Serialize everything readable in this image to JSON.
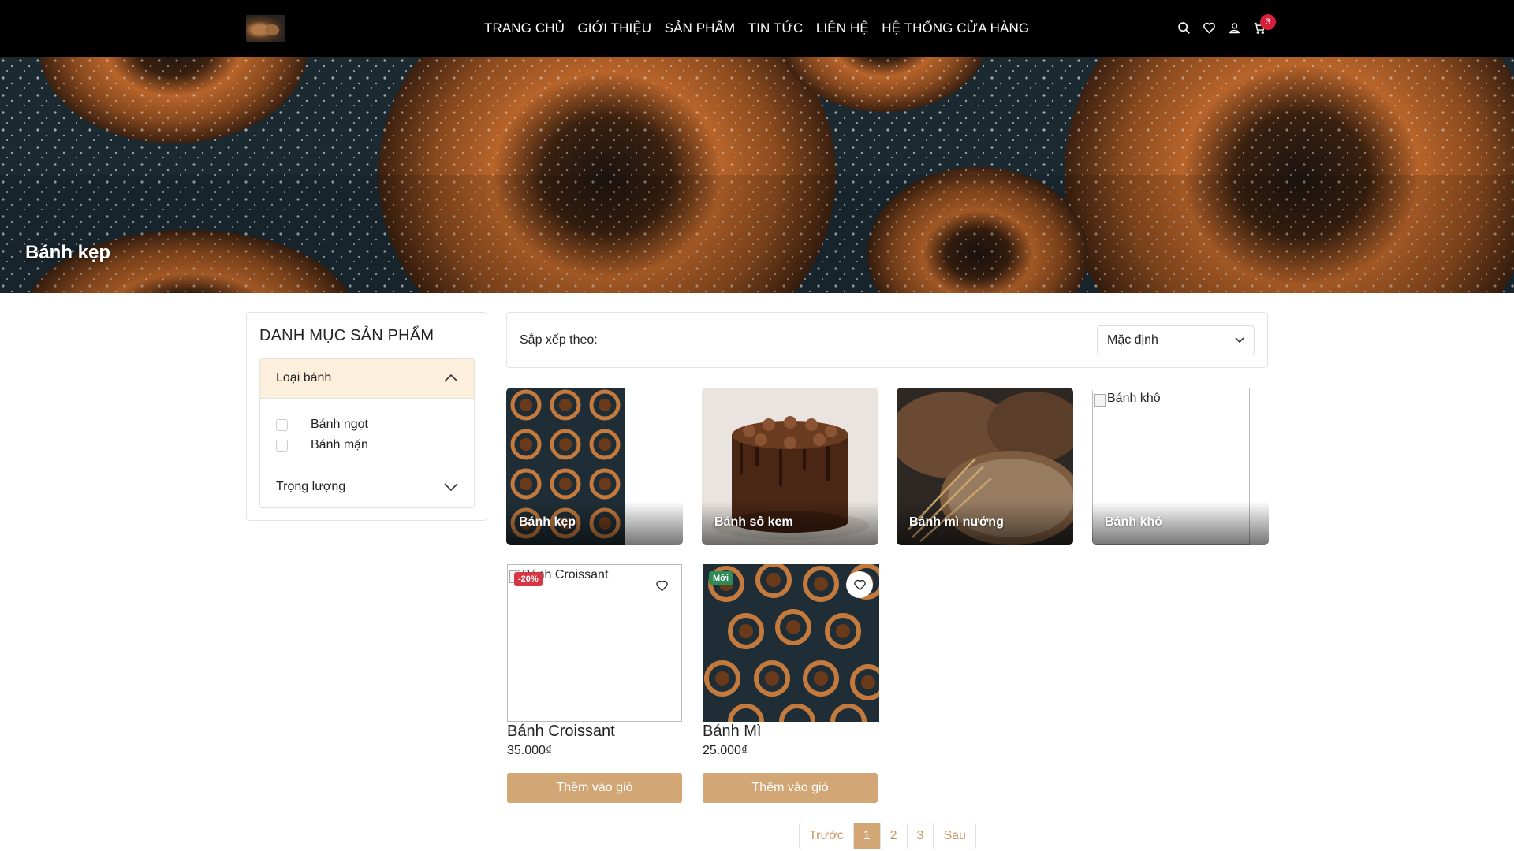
{
  "header": {
    "nav": [
      "TRANG CHỦ",
      "GIỚI THIỆU",
      "SẢN PHẨM",
      "TIN TỨC",
      "LIÊN HỆ",
      "HỆ THỐNG CỬA HÀNG"
    ],
    "cart_count": "3",
    "icons": [
      "search-icon",
      "heart-icon",
      "user-icon",
      "cart-icon"
    ]
  },
  "banner": {
    "title": "Bánh kẹp"
  },
  "sidebar": {
    "title": "DANH MỤC SẢN PHẨM",
    "group1": {
      "label": "Loại bánh",
      "options": [
        "Bánh ngọt",
        "Bánh mặn"
      ]
    },
    "group2": {
      "label": "Trọng lượng"
    }
  },
  "sort": {
    "label": "Sắp xếp theo:",
    "selected": "Mặc định"
  },
  "categories": [
    {
      "label": "Bánh kẹp"
    },
    {
      "label": "Bánh sô kem"
    },
    {
      "label": "Bánh mì nướng"
    },
    {
      "label": "Bánh khô",
      "alt": "Bánh khô"
    }
  ],
  "products": [
    {
      "alt": "Bánh Croissant",
      "name": "Bánh Croissant",
      "price": "35.000₫",
      "tag": "-20%",
      "button": "Thêm vào giỏ"
    },
    {
      "name": "Bánh Mì",
      "price": "25.000₫",
      "tag": "Mới",
      "button": "Thêm vào giỏ"
    }
  ],
  "pagination": {
    "prev": "Trước",
    "pages": [
      "1",
      "2",
      "3"
    ],
    "next": "Sau",
    "current": "1"
  },
  "colors": {
    "accent": "#d2a675",
    "header_bg": "#000000",
    "badge": "#d61f3a",
    "new_tag": "#2e8b57",
    "sale_tag": "#d63545"
  }
}
